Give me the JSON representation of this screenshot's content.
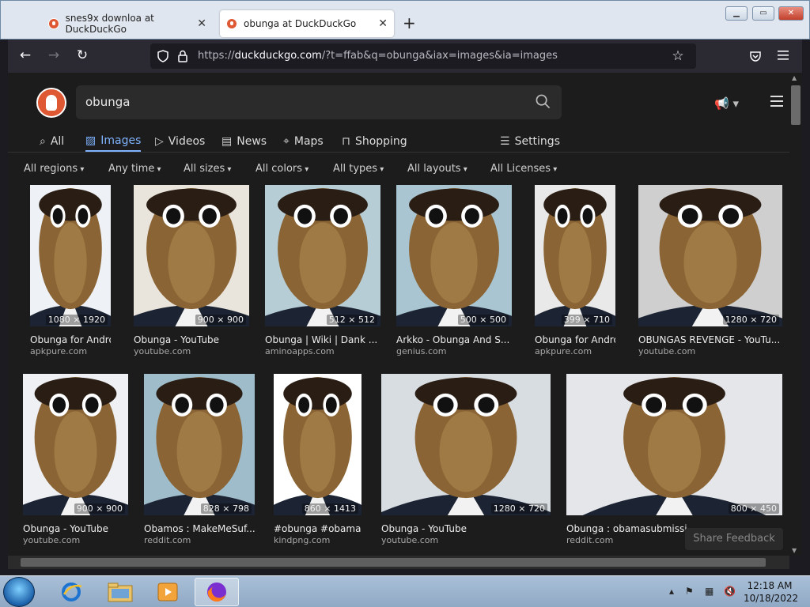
{
  "browser": {
    "tabs": [
      {
        "title": "snes9x downloa at DuckDuckGo",
        "active": false
      },
      {
        "title": "obunga at DuckDuckGo",
        "active": true
      }
    ],
    "new_tab_label": "+",
    "url_prefix": "https://",
    "url_domain": "duckduckgo.com",
    "url_rest": "/?t=ffab&q=obunga&iax=images&ia=images"
  },
  "search": {
    "query": "obunga"
  },
  "verticals": [
    {
      "label": "All"
    },
    {
      "label": "Images"
    },
    {
      "label": "Videos"
    },
    {
      "label": "News"
    },
    {
      "label": "Maps"
    },
    {
      "label": "Shopping"
    }
  ],
  "settings_label": "Settings",
  "filters": [
    "All regions",
    "Any time",
    "All sizes",
    "All colors",
    "All types",
    "All layouts",
    "All Licenses"
  ],
  "results": [
    {
      "title": "Obunga for Androi...",
      "source": "apkpure.com",
      "dims": "1080 × 1920"
    },
    {
      "title": "Obunga - YouTube",
      "source": "youtube.com",
      "dims": "900 × 900"
    },
    {
      "title": "Obunga | Wiki | Dank ...",
      "source": "aminoapps.com",
      "dims": "512 × 512"
    },
    {
      "title": "Arkko - Obunga And S...",
      "source": "genius.com",
      "dims": "500 × 500"
    },
    {
      "title": "Obunga for Androi...",
      "source": "apkpure.com",
      "dims": "399 × 710"
    },
    {
      "title": "OBUNGAS REVENGE - YouTu...",
      "source": "youtube.com",
      "dims": "1280 × 720"
    },
    {
      "title": "Obunga - YouTube",
      "source": "youtube.com",
      "dims": "900 × 900"
    },
    {
      "title": "Obamos : MakeMeSuf...",
      "source": "reddit.com",
      "dims": "828 × 798"
    },
    {
      "title": "#obunga #obama ...",
      "source": "kindpng.com",
      "dims": "860 × 1413"
    },
    {
      "title": "Obunga - YouTube",
      "source": "youtube.com",
      "dims": "1280 × 720"
    },
    {
      "title": "Obunga : obamasubmissi...",
      "source": "reddit.com",
      "dims": "800 × 450"
    }
  ],
  "feedback_label": "Share Feedback",
  "taskbar": {
    "time": "12:18 AM",
    "date": "10/18/2022"
  },
  "colors": {
    "accent": "#7fb3ff",
    "page_bg": "#1c1c1c",
    "toolbar_bg": "#2b2a33",
    "ddg_orange": "#de5833"
  }
}
